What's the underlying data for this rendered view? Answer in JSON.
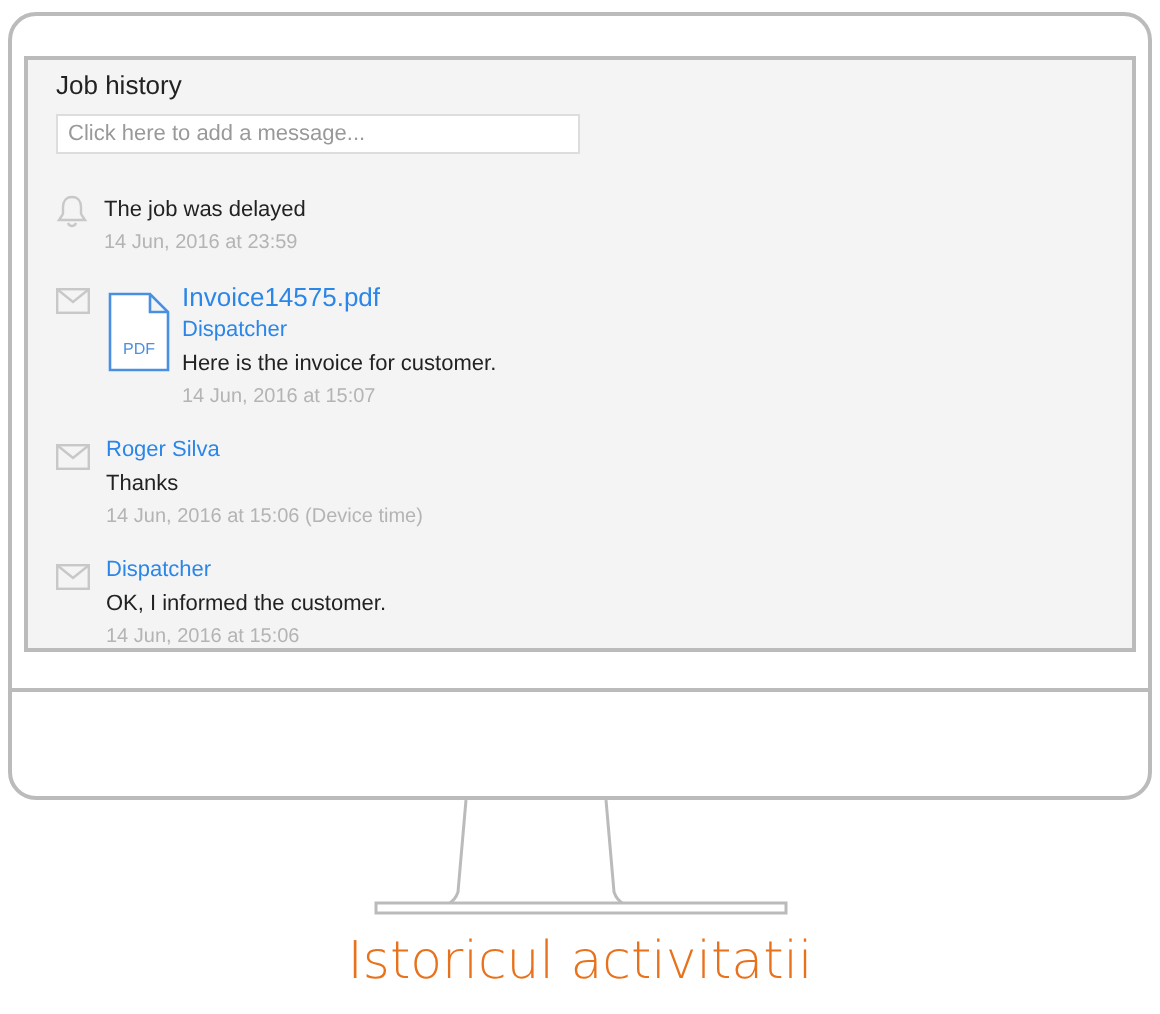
{
  "panel": {
    "title": "Job history",
    "message_field": {
      "placeholder": "Click here to add a message..."
    }
  },
  "entries": [
    {
      "kind": "alert",
      "text": "The job was delayed",
      "time": "14 Jun, 2016 at 23:59"
    },
    {
      "kind": "attachment",
      "file_name": "Invoice14575.pdf",
      "file_type": "PDF",
      "sender": "Dispatcher",
      "text": "Here is the invoice for customer.",
      "time": "14 Jun, 2016 at 15:07"
    },
    {
      "kind": "message",
      "sender": "Roger Silva",
      "text": "Thanks",
      "time": "14 Jun, 2016 at 15:06 (Device time)"
    },
    {
      "kind": "message",
      "sender": "Dispatcher",
      "text": "OK, I informed the customer.",
      "time": "14 Jun, 2016 at 15:06"
    }
  ],
  "caption": "Istoricul activitatii"
}
